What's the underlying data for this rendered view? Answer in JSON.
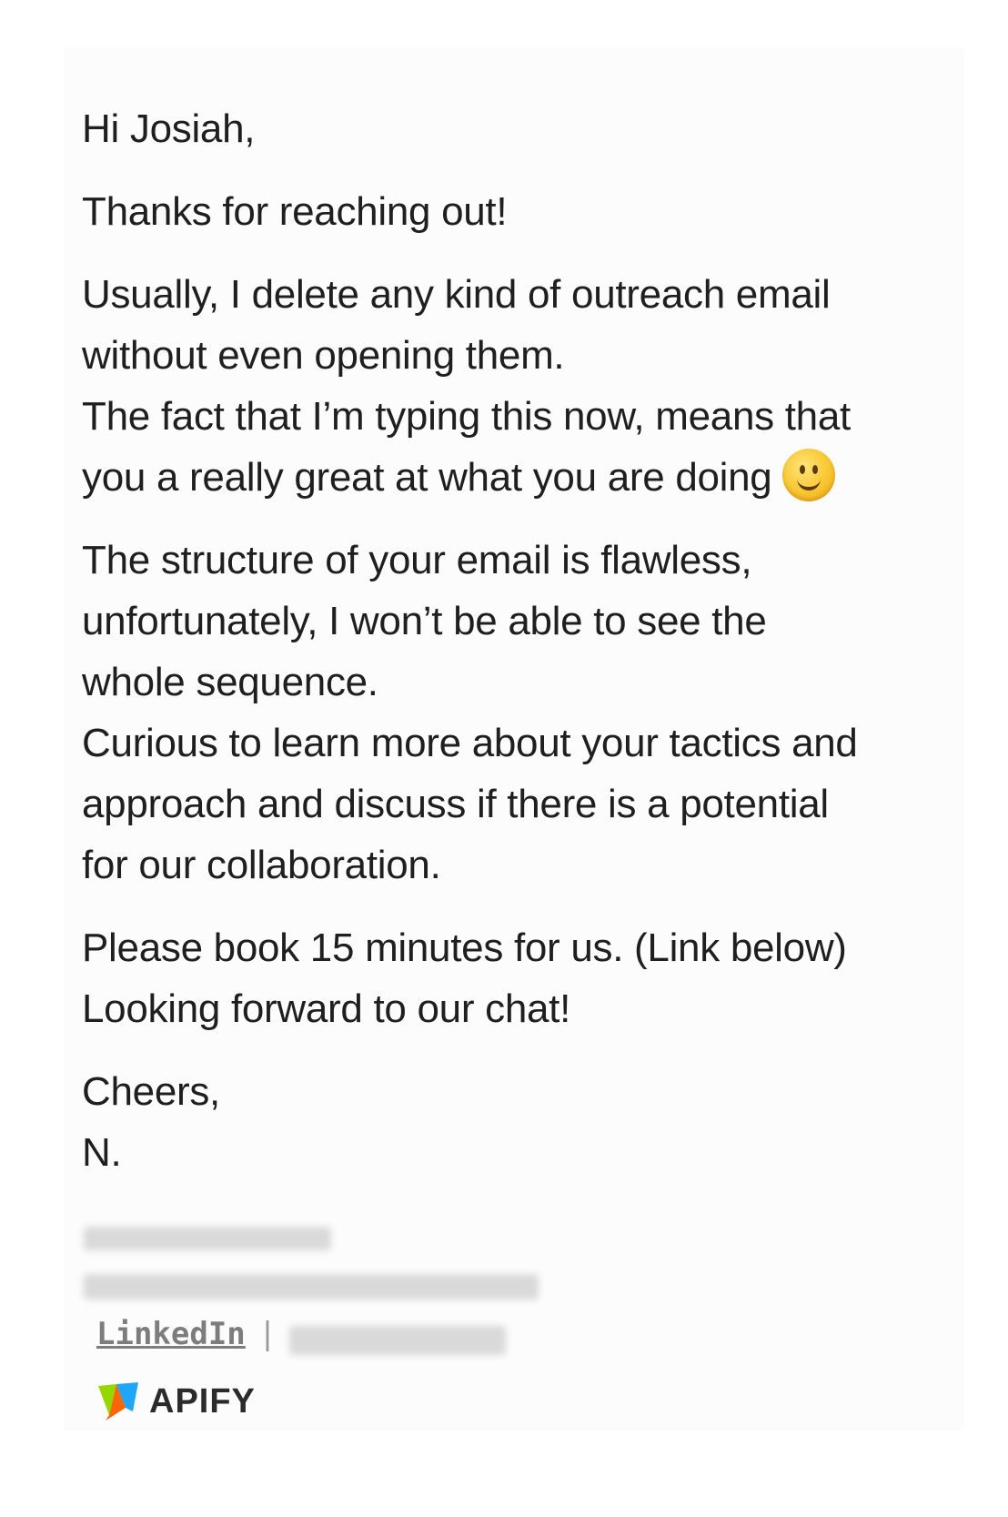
{
  "email": {
    "greeting": "Hi Josiah,",
    "paragraphs": [
      [
        "Thanks for reaching out!"
      ],
      [
        "Usually, I delete any kind of outreach email",
        "without even opening them.",
        "The fact that I’m typing this now, means that",
        "you a really great at what you are doing"
      ],
      [
        "The structure of your email is flawless,",
        "unfortunately, I won’t be able to see the",
        "whole sequence.",
        "Curious to learn more about your tactics and",
        "approach and discuss if there is a potential",
        "for our collaboration."
      ],
      [
        "Please book 15 minutes for us. (Link below)",
        "Looking forward to our chat!"
      ],
      [
        "Cheers,",
        "N."
      ]
    ],
    "smile_emoji": "slightly-smiling-face-icon"
  },
  "signature": {
    "linkedin_label": "LinkedIn",
    "separator": "|",
    "company_name": "APIFY",
    "logo_icon": "apify-logo-icon"
  },
  "colors": {
    "text": "#1f1f1f",
    "link": "#7d7d7d",
    "panel": "#fcfcfc"
  }
}
